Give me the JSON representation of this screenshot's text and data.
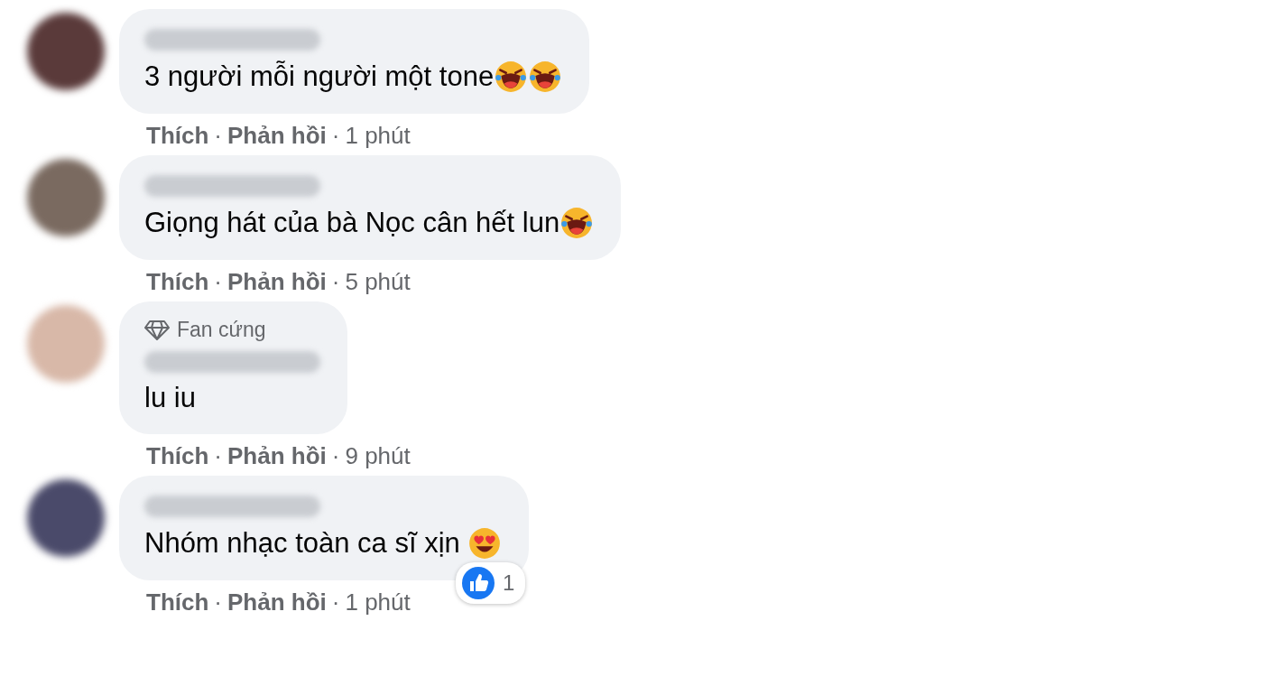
{
  "comments": [
    {
      "text": "3 người mỗi người một tone",
      "emojis": [
        {
          "kind": "rofl"
        },
        {
          "kind": "rofl"
        }
      ],
      "actions": [
        {
          "kind": "link",
          "text": "Thích"
        },
        {
          "kind": "dot",
          "text": "·"
        },
        {
          "kind": "link",
          "text": "Phản hồi"
        },
        {
          "kind": "dot",
          "text": "·"
        },
        {
          "kind": "time",
          "text": "1 phút"
        }
      ]
    },
    {
      "text": "Giọng hát của bà Nọc cân hết lun",
      "emojis": [
        {
          "kind": "rofl"
        }
      ],
      "actions": [
        {
          "kind": "link",
          "text": "Thích"
        },
        {
          "kind": "dot",
          "text": "·"
        },
        {
          "kind": "link",
          "text": "Phản hồi"
        },
        {
          "kind": "dot",
          "text": "·"
        },
        {
          "kind": "time",
          "text": "5 phút"
        }
      ]
    },
    {
      "badge": {
        "label": "Fan cứng"
      },
      "text": "lu iu",
      "actions": [
        {
          "kind": "link",
          "text": "Thích"
        },
        {
          "kind": "dot",
          "text": "·"
        },
        {
          "kind": "link",
          "text": "Phản hồi"
        },
        {
          "kind": "dot",
          "text": "·"
        },
        {
          "kind": "time",
          "text": "9 phút"
        }
      ]
    },
    {
      "text": "Nhóm nhạc toàn ca sĩ xịn ",
      "emojis": [
        {
          "kind": "heart-eyes"
        }
      ],
      "reaction": {
        "count": "1"
      },
      "actions": [
        {
          "kind": "link",
          "text": "Thích"
        },
        {
          "kind": "dot",
          "text": "·"
        },
        {
          "kind": "link",
          "text": "Phản hồi"
        },
        {
          "kind": "dot",
          "text": "·"
        },
        {
          "kind": "time",
          "text": "1 phút"
        }
      ]
    }
  ]
}
